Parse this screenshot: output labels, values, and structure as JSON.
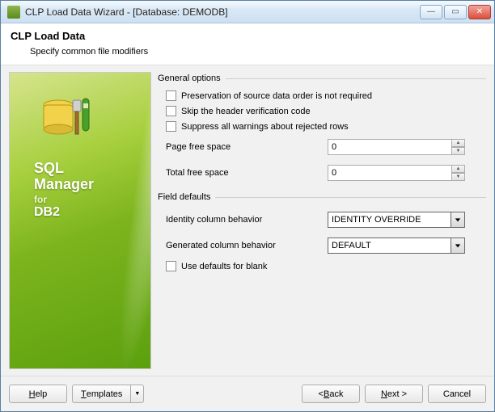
{
  "title": "CLP Load Data Wizard - [Database: DEMODB]",
  "header": {
    "title": "CLP Load Data",
    "subtitle": "Specify common file modifiers"
  },
  "sidebar": {
    "l1": "SQL",
    "l2": "Manager",
    "l3": "for",
    "l4": "DB2"
  },
  "general": {
    "group": "General options",
    "chk_preserve": "Preservation of source data order is not required",
    "chk_skip": "Skip the header verification code",
    "chk_suppress": "Suppress all warnings about rejected rows",
    "page_free_label": "Page free space",
    "page_free_value": "0",
    "total_free_label": "Total free space",
    "total_free_value": "0"
  },
  "defaults": {
    "group": "Field defaults",
    "identity_label": "Identity column behavior",
    "identity_value": "IDENTITY OVERRIDE",
    "generated_label": "Generated column behavior",
    "generated_value": "DEFAULT",
    "chk_use_defaults": "Use defaults for blank"
  },
  "footer": {
    "help": "Help",
    "templates": "Templates",
    "back": "< Back",
    "next": "Next >",
    "cancel": "Cancel"
  }
}
